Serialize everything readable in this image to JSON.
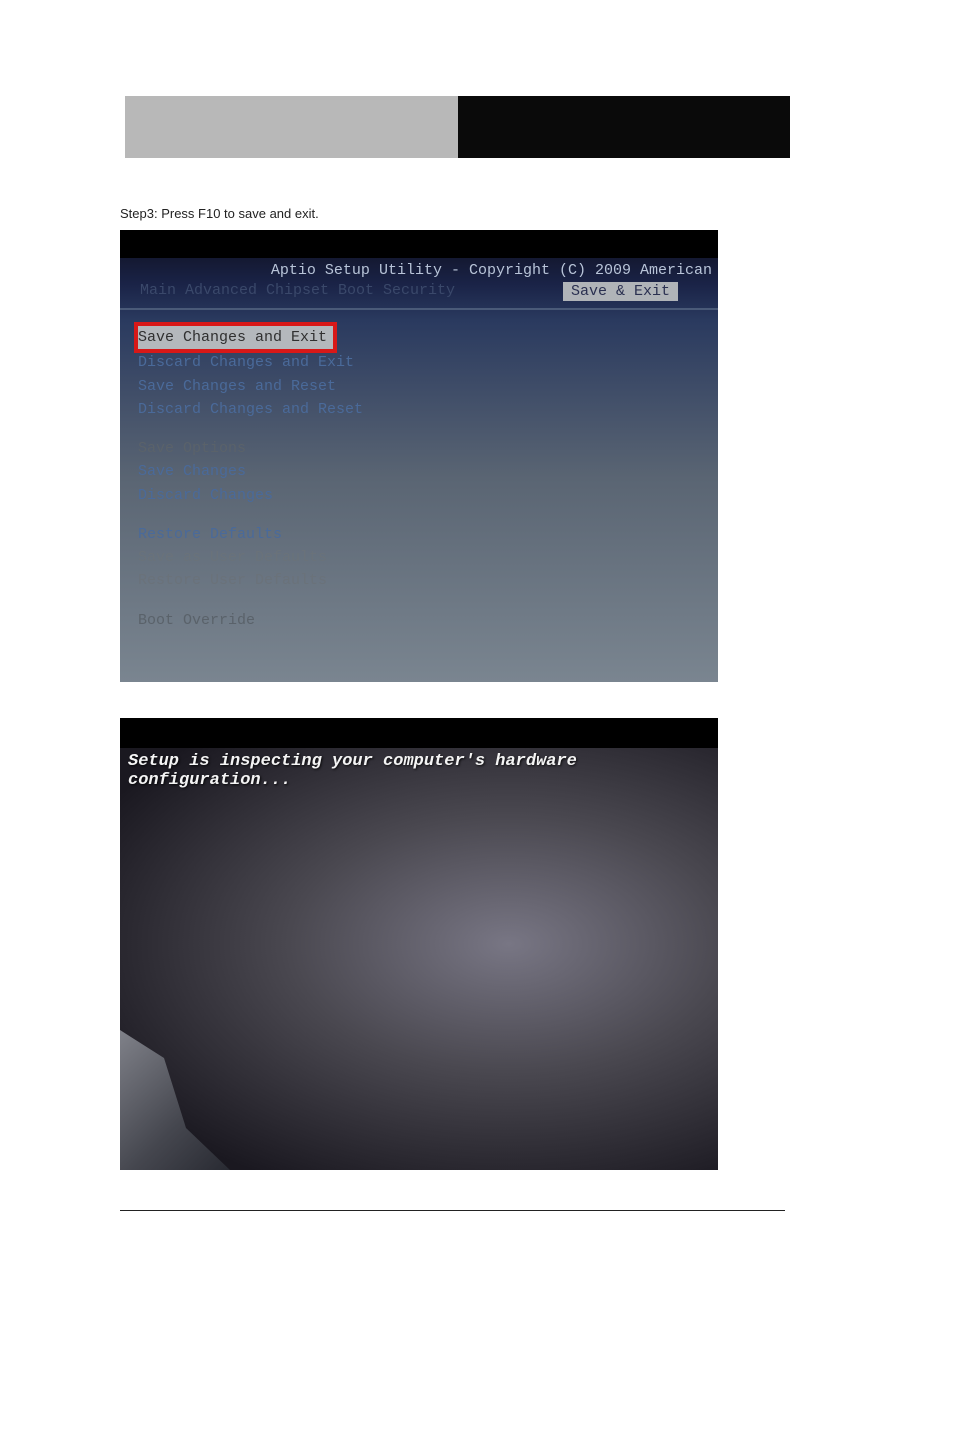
{
  "step_instruction": "Step3: Press F10 to save and exit.",
  "bios": {
    "title": "Aptio Setup Utility - Copyright (C) 2009 American",
    "tabs_inactive": "Main  Advanced  Chipset  Boot  Security",
    "tab_active": "Save & Exit",
    "items": {
      "save_exit": "Save Changes and Exit",
      "discard_exit": "Discard Changes and Exit",
      "save_reset": "Save Changes and Reset",
      "discard_reset": "Discard Changes and Reset",
      "save_options_hdr": "Save Options",
      "save_changes": "Save Changes",
      "discard_changes": "Discard Changes",
      "restore_defaults": "Restore Defaults",
      "save_user_defaults": "Save as User Defaults",
      "restore_user_defaults": "Restore User Defaults",
      "boot_override_hdr": "Boot Override"
    }
  },
  "setup": {
    "message": "Setup is inspecting your computer's hardware configuration..."
  }
}
